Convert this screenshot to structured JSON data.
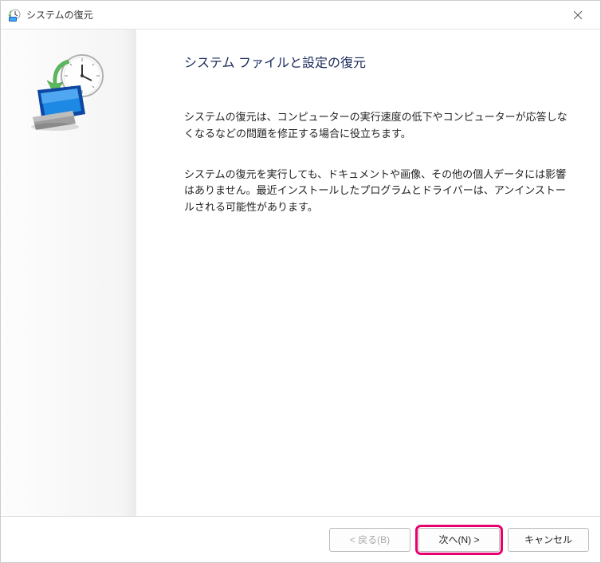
{
  "titlebar": {
    "title": "システムの復元"
  },
  "content": {
    "heading": "システム ファイルと設定の復元",
    "paragraph1": "システムの復元は、コンピューターの実行速度の低下やコンピューターが応答しなくなるなどの問題を修正する場合に役立ちます。",
    "paragraph2": "システムの復元を実行しても、ドキュメントや画像、その他の個人データには影響はありません。最近インストールしたプログラムとドライバーは、アンインストールされる可能性があります。"
  },
  "footer": {
    "back": "< 戻る(B)",
    "next": "次へ(N) >",
    "cancel": "キャンセル"
  }
}
